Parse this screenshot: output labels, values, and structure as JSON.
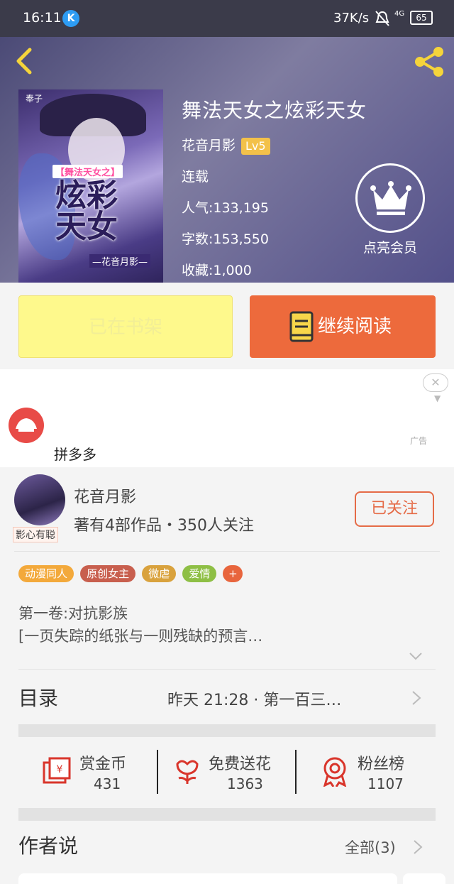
{
  "status_bar": {
    "time": "16:11",
    "k_badge": "K",
    "net_speed": "37K/s",
    "signal": "4G",
    "battery": "65"
  },
  "book": {
    "title": "舞法天女之炫彩天女",
    "author": "花音月影",
    "level": "Lv5",
    "status": "连载",
    "popularity": "人气:133,195",
    "word_count": "字数:153,550",
    "favorites": "收藏:1,000",
    "cover": {
      "mark": "奉子",
      "subtitle": "【舞法天女之】",
      "title": "炫彩天女",
      "author_line": "—花音月影—"
    }
  },
  "vip": {
    "label": "点亮会员"
  },
  "actions": {
    "shelf_label": "已在书架",
    "read_label": "继续阅读"
  },
  "ad": {
    "name": "拼多多",
    "tag": "广告"
  },
  "author_card": {
    "name": "花音月影",
    "stats": "著有4部作品・350人关注",
    "avatar_tag": "影心有聪",
    "follow_label": "已关注"
  },
  "tags": [
    {
      "label": "动漫同人",
      "color": "#f3a93b"
    },
    {
      "label": "原创女主",
      "color": "#c85f4e"
    },
    {
      "label": "微虐",
      "color": "#d9a23d"
    },
    {
      "label": "爱情",
      "color": "#8ebf45"
    },
    {
      "label": "+",
      "color": "#e8653d"
    }
  ],
  "intro": {
    "line1": "第一卷:对抗影族",
    "line2": "[一页失踪的纸张与一则残缺的预言…"
  },
  "toc": {
    "title": "目录",
    "latest": "昨天  21:28   ·   第一百三…"
  },
  "stats": [
    {
      "label": "赏金币",
      "value": "431",
      "icon": "coin-envelope-icon"
    },
    {
      "label": "免费送花",
      "value": "1363",
      "icon": "flower-icon"
    },
    {
      "label": "粉丝榜",
      "value": "1107",
      "icon": "ribbon-medal-icon"
    }
  ],
  "author_say": {
    "title": "作者说",
    "all_label": "全部(3)"
  },
  "colors": {
    "accent": "#ed6a3c",
    "shelf_button": "#fef98c",
    "hero_bg": "#5b5889"
  }
}
